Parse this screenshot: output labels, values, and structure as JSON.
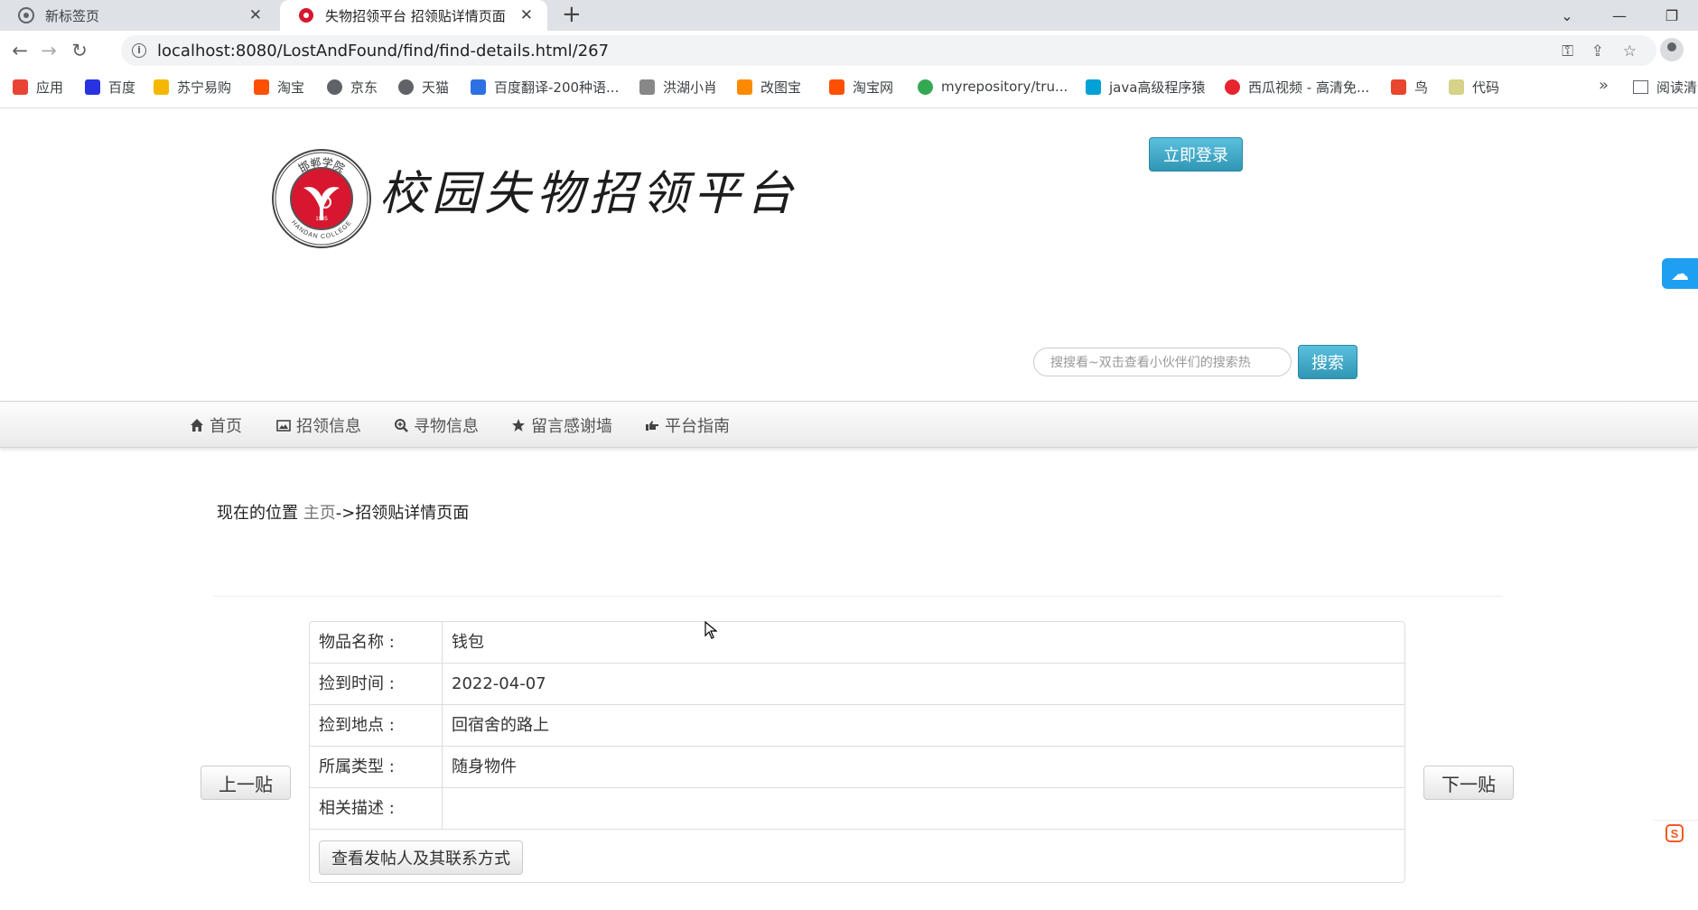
{
  "browser": {
    "tabs": [
      {
        "title": "新标签页",
        "active": false
      },
      {
        "title": "失物招领平台 招领贴详情页面",
        "active": true
      }
    ],
    "url": "localhost:8080/LostAndFound/find/find-details.html/267",
    "bookmarks": [
      {
        "label": "应用",
        "icon": "apps-grid-icon",
        "color": "#ea4335"
      },
      {
        "label": "百度",
        "icon": "baidu-paw-icon",
        "color": "#2932e1"
      },
      {
        "label": "苏宁易购",
        "icon": "suning-lion-icon",
        "color": "#f5b800"
      },
      {
        "label": "淘宝",
        "icon": "taobao-icon",
        "color": "#ff5000"
      },
      {
        "label": "京东",
        "icon": "globe-icon",
        "color": "#5f6368"
      },
      {
        "label": "天猫",
        "icon": "globe-icon",
        "color": "#5f6368"
      },
      {
        "label": "百度翻译-200种语...",
        "icon": "translate-icon",
        "color": "#2f6fe4"
      },
      {
        "label": "洪湖小肖",
        "icon": "rocket-icon",
        "color": "#888888"
      },
      {
        "label": "改图宝",
        "icon": "image-edit-icon",
        "color": "#ff8a00"
      },
      {
        "label": "淘宝网",
        "icon": "taobao-icon",
        "color": "#ff5000"
      },
      {
        "label": "myrepository/tru...",
        "icon": "chrome-icon",
        "color": "#34a853"
      },
      {
        "label": "java高级程序猿",
        "icon": "bilibili-tv-icon",
        "color": "#00a1d6"
      },
      {
        "label": "西瓜视频 - 高清免...",
        "icon": "xigua-play-icon",
        "color": "#e5242f"
      },
      {
        "label": "鸟",
        "icon": "bird-icon",
        "color": "#e8462e"
      },
      {
        "label": "代码",
        "icon": "code-leaf-icon",
        "color": "#d6d28a"
      }
    ],
    "more_bookmarks": "»",
    "reading_list": "阅读清"
  },
  "header": {
    "site_title": "校园失物招领平台",
    "logo_text_top": "邯郸学院",
    "logo_text_bottom": "HANDAN COLLEGE",
    "logo_year": "1905",
    "login_button": "立即登录"
  },
  "search": {
    "placeholder": "搜搜看~双击查看小伙伴们的搜索热",
    "button": "搜索"
  },
  "nav": [
    {
      "label": "首页",
      "icon": "home-icon"
    },
    {
      "label": "招领信息",
      "icon": "picture-icon"
    },
    {
      "label": "寻物信息",
      "icon": "zoom-in-icon"
    },
    {
      "label": "留言感谢墙",
      "icon": "star-icon"
    },
    {
      "label": "平台指南",
      "icon": "hand-right-icon"
    }
  ],
  "breadcrumb": {
    "prefix": "现在的位置",
    "home": "主页",
    "current": "->招领贴详情页面"
  },
  "details": {
    "rows": [
      {
        "label": "物品名称 :",
        "value": "钱包"
      },
      {
        "label": "捡到时间 :",
        "value": "2022-04-07"
      },
      {
        "label": "捡到地点 :",
        "value": "回宿舍的路上"
      },
      {
        "label": "所属类型 :",
        "value": "随身物件"
      },
      {
        "label": "相关描述 :",
        "value": ""
      }
    ],
    "contact_button": "查看发帖人及其联系方式"
  },
  "pager": {
    "prev": "上一贴",
    "next": "下一贴"
  },
  "colors": {
    "button_blue": "#31b0d5",
    "logo_red": "#d7172f",
    "side_widget": "#1e9ff2"
  }
}
